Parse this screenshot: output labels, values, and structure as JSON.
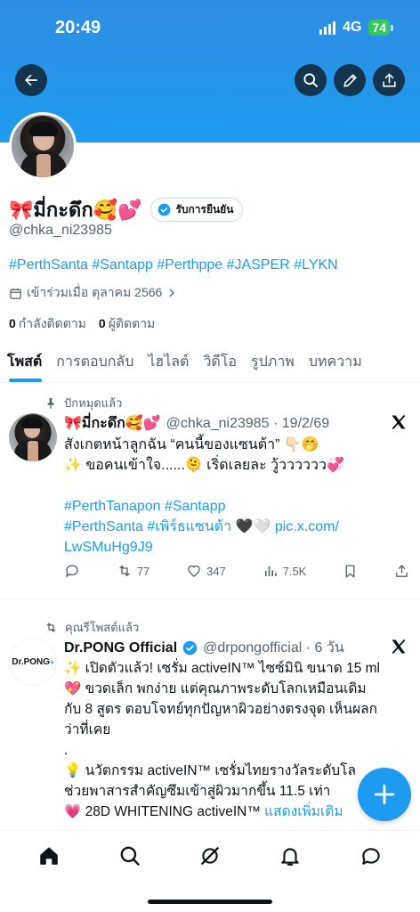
{
  "status_bar": {
    "time": "20:49",
    "network": "4G",
    "battery": "74"
  },
  "profile": {
    "display_name": "🎀มี่กะดึก🥰💕",
    "verified_label": "รับการยืนยัน",
    "handle": "@chka_ni23985",
    "hashtags": "#PerthSanta #Santapp #Perthppe #JASPER #LYKN",
    "joined": "เข้าร่วมเมื่อ ตุลาคม 2566",
    "following_count": "0",
    "following_label": "กำลังติดตาม",
    "followers_count": "0",
    "followers_label": "ผู้ติดตาม"
  },
  "tabs": [
    {
      "label": "โพสต์",
      "active": true
    },
    {
      "label": "การตอบกลับ",
      "active": false
    },
    {
      "label": "ไฮไลต์",
      "active": false
    },
    {
      "label": "วิดีโอ",
      "active": false
    },
    {
      "label": "รูปภาพ",
      "active": false
    },
    {
      "label": "บทความ",
      "active": false
    }
  ],
  "tweet1": {
    "pinned_label": "ปักหมุดแล้ว",
    "name": "🎀มี่กะดึก🥰💕",
    "meta": "@chka_ni23985 · 19/2/69",
    "line1": "สังเกตหน้าลูกฉัน “คนนี้ของแซนต้า” 👇🏻🤭",
    "line2": "✨ ขอคนเข้าใจ......🫠 เริ่ดเลยละ วู้วววววว💞",
    "hashtags1": "#PerthTanapon #Santapp",
    "hashtags2": "#PerthSanta #เพิร์ธแซนต้า",
    "hearts": "🖤🤍",
    "link1": "pic.x.com/",
    "link2": "LwSMuHg9J9",
    "retweets": "77",
    "likes": "347",
    "views": "7.5K"
  },
  "tweet2": {
    "repost_label": "คุณรีโพสต์แล้ว",
    "avatar_text": "Dr.PONG",
    "name": "Dr.PONG Official",
    "meta": "@drpongofficial · 6 วัน",
    "line1": "✨ เปิดตัวแล้ว! เซรั่ม activeIN™ ไซซ์มินิ ขนาด 15 ml",
    "line2": "💖 ขวดเล็ก พกง่าย แต่คุณภาพระดับโลกเหมือนเดิม",
    "line3": "กับ 8 สูตร ตอบโจทย์ทุกปัญหาผิวอย่างตรงจุด เห็นผลก",
    "line4": "ว่าที่เคย",
    "line5": ".",
    "line6": "💡 นวัตกรรม activeIN™ เซรั่มไทยรางวัลระดับโล",
    "line7": "ช่วยพาสารสำคัญซึมเข้าสู่ผิวมากขึ้น 11.5 เท่า",
    "line8": "💗 28D WHITENING activeIN™",
    "show_more": "แสดงเพิ่มเติม"
  },
  "colors": {
    "accent": "#1d9bf0",
    "text": "#0f1419",
    "muted": "#536471"
  },
  "icons": [
    "back-arrow-icon",
    "search-icon",
    "pencil-icon",
    "share-icon",
    "calendar-icon",
    "chevron-right-icon",
    "pin-icon",
    "repost-icon",
    "x-logo-icon",
    "reply-icon",
    "retweet-icon",
    "like-icon",
    "views-icon",
    "bookmark-icon",
    "plus-icon",
    "home-icon",
    "grok-icon",
    "bell-icon",
    "messages-icon"
  ]
}
